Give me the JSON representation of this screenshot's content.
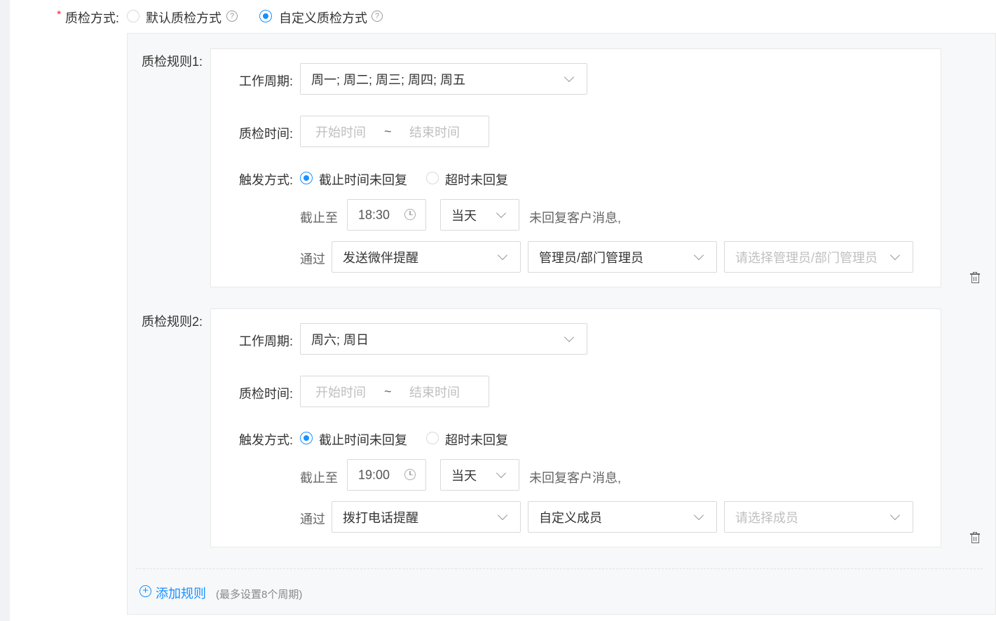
{
  "top": {
    "required_mark": "*",
    "label": "质检方式:",
    "option_default": "默认质检方式",
    "option_custom": "自定义质检方式",
    "selected": "custom"
  },
  "icons": {
    "help": "question-circle-icon",
    "chevron": "chevron-down-icon",
    "clock": "clock-icon",
    "trash": "trash-icon",
    "add": "plus-circle-icon"
  },
  "colors": {
    "accent": "#1890ff",
    "placeholder": "#bfbfbf",
    "border": "#d9d9d9"
  },
  "rules": [
    {
      "title": "质检规则1:",
      "work_cycle_label": "工作周期:",
      "work_cycle_value": "周一; 周二; 周三; 周四; 周五",
      "time_label": "质检时间:",
      "start_placeholder": "开始时间",
      "range_sep": "~",
      "end_placeholder": "结束时间",
      "trigger_label": "触发方式:",
      "trigger_opt1": "截止时间未回复",
      "trigger_opt2": "超时未回复",
      "trigger_selected": "截止时间未回复",
      "deadline_label": "截止至",
      "deadline_time": "18:30",
      "day_value": "当天",
      "unreplied_text": "未回复客户消息,",
      "via_label": "通过",
      "method_value": "发送微伴提醒",
      "recipient_type": "管理员/部门管理员",
      "recipient_placeholder": "请选择管理员/部门管理员"
    },
    {
      "title": "质检规则2:",
      "work_cycle_label": "工作周期:",
      "work_cycle_value": "周六; 周日",
      "time_label": "质检时间:",
      "start_placeholder": "开始时间",
      "range_sep": "~",
      "end_placeholder": "结束时间",
      "trigger_label": "触发方式:",
      "trigger_opt1": "截止时间未回复",
      "trigger_opt2": "超时未回复",
      "trigger_selected": "截止时间未回复",
      "deadline_label": "截止至",
      "deadline_time": "19:00",
      "day_value": "当天",
      "unreplied_text": "未回复客户消息,",
      "via_label": "通过",
      "method_value": "拨打电话提醒",
      "recipient_type": "自定义成员",
      "recipient_placeholder": "请选择成员"
    }
  ],
  "add_rule": {
    "label": "添加规则",
    "hint": "(最多设置8个周期)"
  }
}
